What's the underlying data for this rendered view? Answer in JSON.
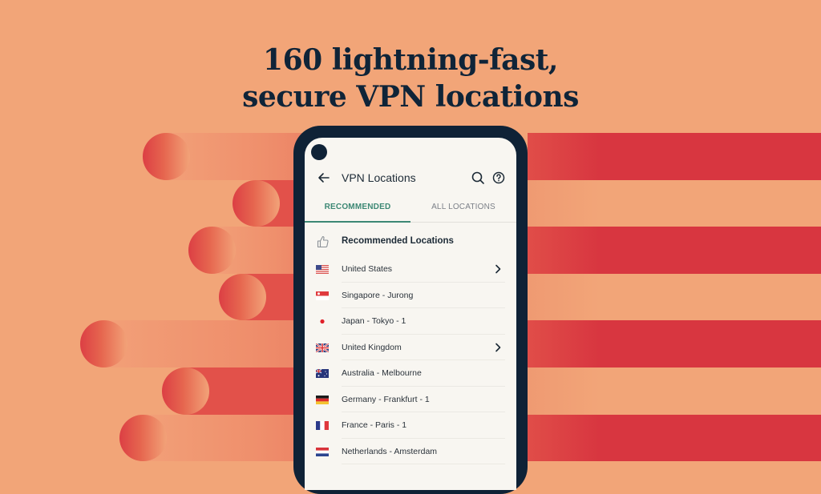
{
  "headline": {
    "line1": "160 lightning-fast,",
    "line2": "secure VPN locations"
  },
  "colors": {
    "background": "#f2a578",
    "stripe_red": "#d83640",
    "phone_frame": "#0f2236",
    "screen_bg": "#f8f6f1",
    "accent": "#3c8874",
    "text_dark": "#1c2a36"
  },
  "app": {
    "title": "VPN Locations",
    "back_icon": "arrow-left-icon",
    "actions": [
      {
        "name": "search",
        "icon": "search-icon"
      },
      {
        "name": "help",
        "icon": "help-circle-icon"
      }
    ],
    "tabs": [
      {
        "label": "RECOMMENDED",
        "active": true
      },
      {
        "label": "ALL LOCATIONS",
        "active": false
      }
    ],
    "section": {
      "icon": "thumbs-up-icon",
      "title": "Recommended Locations"
    },
    "locations": [
      {
        "label": "United States",
        "flag": "us-flag-icon",
        "expandable": true
      },
      {
        "label": "Singapore - Jurong",
        "flag": "sg-flag-icon",
        "expandable": false
      },
      {
        "label": "Japan - Tokyo - 1",
        "flag": "jp-flag-icon",
        "expandable": false
      },
      {
        "label": "United Kingdom",
        "flag": "uk-flag-icon",
        "expandable": true
      },
      {
        "label": "Australia - Melbourne",
        "flag": "au-flag-icon",
        "expandable": false
      },
      {
        "label": "Germany - Frankfurt - 1",
        "flag": "de-flag-icon",
        "expandable": false
      },
      {
        "label": "France - Paris - 1",
        "flag": "fr-flag-icon",
        "expandable": false
      },
      {
        "label": "Netherlands - Amsterdam",
        "flag": "nl-flag-icon",
        "expandable": false
      }
    ]
  }
}
